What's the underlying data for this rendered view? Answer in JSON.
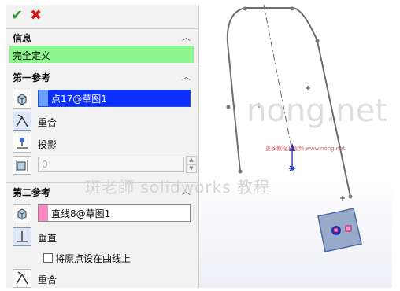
{
  "toolbar": {
    "ok_glyph": "✔",
    "cancel_glyph": "✖"
  },
  "info": {
    "title": "信息",
    "status": "完全定义"
  },
  "ref1": {
    "title": "第一参考",
    "entity": "点17@草图1",
    "entity_color": "#6aa0ff",
    "relations": [
      "重合",
      "投影"
    ],
    "distance": "0"
  },
  "ref2": {
    "title": "第二参考",
    "entity": "直线8@草图1",
    "entity_color": "#ff88c4",
    "relations": [
      "垂直",
      "重合"
    ],
    "checkbox_label": "将原点设在曲线上"
  },
  "watermark": {
    "site": "nong.net",
    "caption": "斑老師 solidworks 教程",
    "small": "更多教程及视频 www.nong.net"
  },
  "icons": [
    "check-icon",
    "close-icon",
    "chevron-up-icon",
    "cube-icon",
    "coincident-icon",
    "projection-icon",
    "distance-icon",
    "perpendicular-icon"
  ]
}
